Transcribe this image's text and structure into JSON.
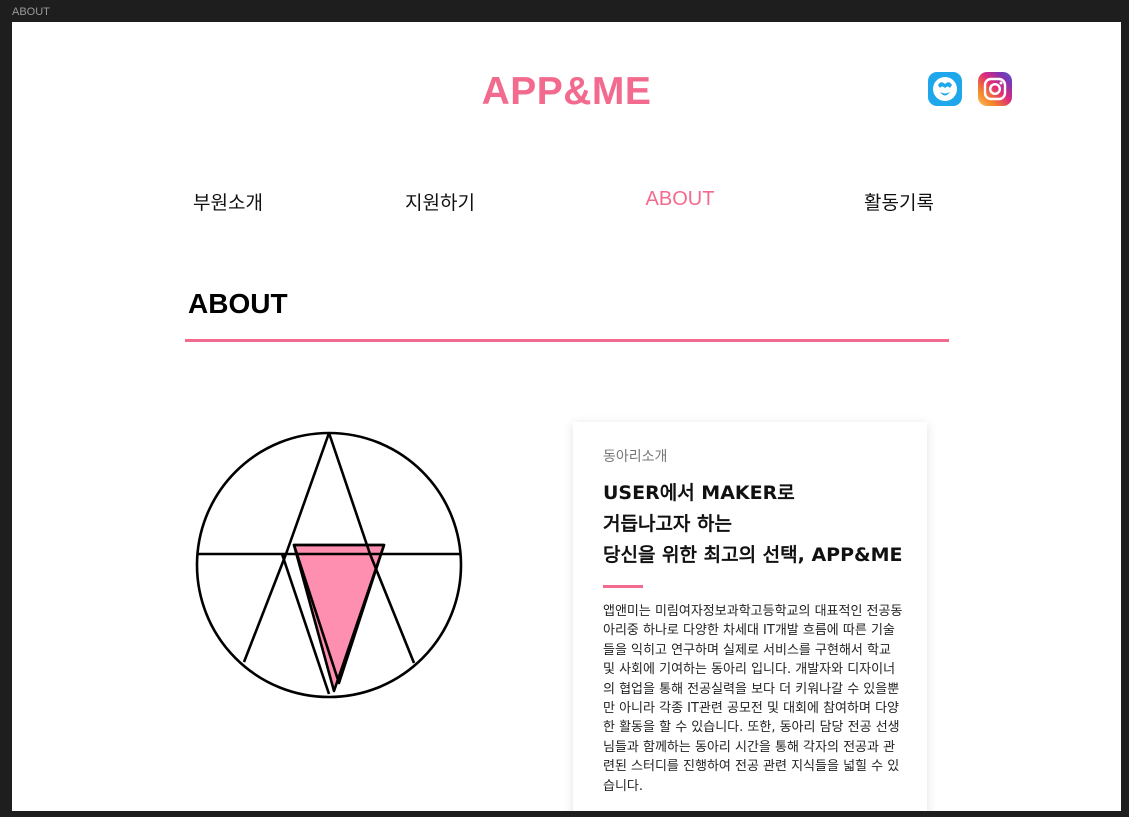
{
  "window": {
    "title": "ABOUT"
  },
  "header": {
    "logo": "APP&ME",
    "social": [
      {
        "name": "daum-cafe",
        "icon": "cafe-icon",
        "color": "#1ea7ea"
      },
      {
        "name": "instagram",
        "icon": "instagram-icon"
      }
    ]
  },
  "nav": {
    "items": [
      {
        "label": "부원소개",
        "active": false
      },
      {
        "label": "지원하기",
        "active": false
      },
      {
        "label": "ABOUT",
        "active": true
      },
      {
        "label": "활동기록",
        "active": false
      }
    ]
  },
  "section": {
    "title": "ABOUT"
  },
  "card": {
    "label": "동아리소개",
    "heading": [
      "USER에서 MAKER로",
      "거듭나고자 하는",
      "당신을 위한 최고의 선택, APP&ME"
    ],
    "body": "앱앤미는 미림여자정보과학고등학교의 대표적인 전공동아리중 하나로 다양한 차세대 IT개발 흐름에 따른 기술들을 익히고 연구하며 실제로 서비스를 구현해서 학교 및 사회에 기여하는 동아리 입니다. 개발자와 디자이너의 협업을 통해 전공실력을 보다 더 키워나갈 수 있을뿐만 아니라 각종 IT관련 공모전 및 대회에 참여하며 다양한 활동을 할 수 있습니다. 또한, 동아리 담당 전공 선생님들과 함께하는 동아리 시간을 통해 각자의 전공과 관련된 스터디를 진행하여 전공 관련 지식들을 넓힐 수 있습니다."
  },
  "colors": {
    "accent": "#f26b8f",
    "emblem_fill": "#ff8fb1"
  }
}
